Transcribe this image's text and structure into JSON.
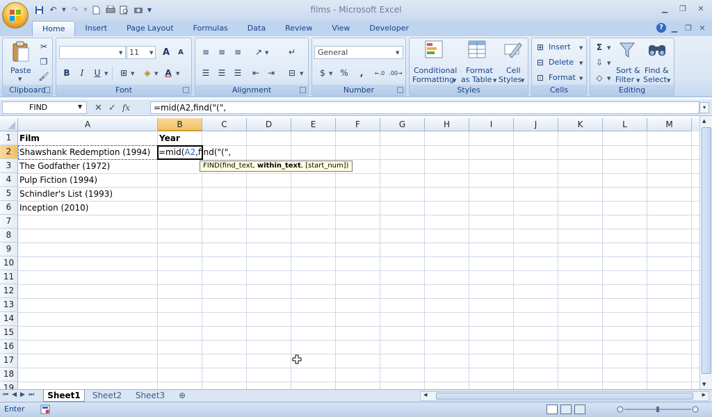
{
  "window": {
    "title": "films - Microsoft Excel"
  },
  "tabs": [
    {
      "label": "Home",
      "active": true
    },
    {
      "label": "Insert"
    },
    {
      "label": "Page Layout"
    },
    {
      "label": "Formulas"
    },
    {
      "label": "Data"
    },
    {
      "label": "Review"
    },
    {
      "label": "View"
    },
    {
      "label": "Developer"
    }
  ],
  "ribbon": {
    "clipboard": {
      "label": "Clipboard",
      "paste": "Paste"
    },
    "font": {
      "label": "Font",
      "font_name": "",
      "font_size": "11",
      "bold": "B",
      "italic": "I",
      "underline": "U",
      "grow": "A",
      "shrink": "A",
      "color": "A"
    },
    "alignment": {
      "label": "Alignment"
    },
    "number": {
      "label": "Number",
      "format": "General",
      "currency": "$",
      "percent": "%",
      "comma": ","
    },
    "styles": {
      "label": "Styles",
      "conditional_1": "Conditional",
      "conditional_2": "Formatting",
      "format_table_1": "Format",
      "format_table_2": "as Table",
      "cell_styles_1": "Cell",
      "cell_styles_2": "Styles"
    },
    "cells": {
      "label": "Cells",
      "insert": "Insert",
      "delete": "Delete",
      "format": "Format"
    },
    "editing": {
      "label": "Editing",
      "sort_1": "Sort &",
      "sort_2": "Filter",
      "find_1": "Find &",
      "find_2": "Select"
    }
  },
  "formula_bar": {
    "name_box": "FIND",
    "fx": "fx",
    "formula": "=mid(A2,find(\"(\","
  },
  "columns": [
    "A",
    "B",
    "C",
    "D",
    "E",
    "F",
    "G",
    "H",
    "I",
    "J",
    "K",
    "L",
    "M"
  ],
  "rows": [
    "1",
    "2",
    "3",
    "4",
    "5",
    "6",
    "7",
    "8",
    "9",
    "10",
    "11",
    "12",
    "13",
    "14",
    "15",
    "16",
    "17",
    "18",
    "19"
  ],
  "cells": {
    "A1": "Film",
    "B1": "Year",
    "A2": "Shawshank Redemption (1994)",
    "A3": "The Godfather (1972)",
    "A4": "Pulp Fiction (1994)",
    "A5": "Schindler's List (1993)",
    "A6": "Inception (2010)"
  },
  "edit": {
    "prefix": "=mid(",
    "ref": "A2",
    "suffix": ",find(\"(\","
  },
  "tooltip": {
    "fn": "FIND(find_text, ",
    "arg": "within_text",
    "rest": ", [start_num])"
  },
  "sheets": [
    "Sheet1",
    "Sheet2",
    "Sheet3"
  ],
  "status": {
    "mode": "Enter"
  },
  "colors": {
    "ribbon_bg": "#d9e6f5",
    "accent": "#15428b",
    "selected_header": "#f1c15f"
  }
}
